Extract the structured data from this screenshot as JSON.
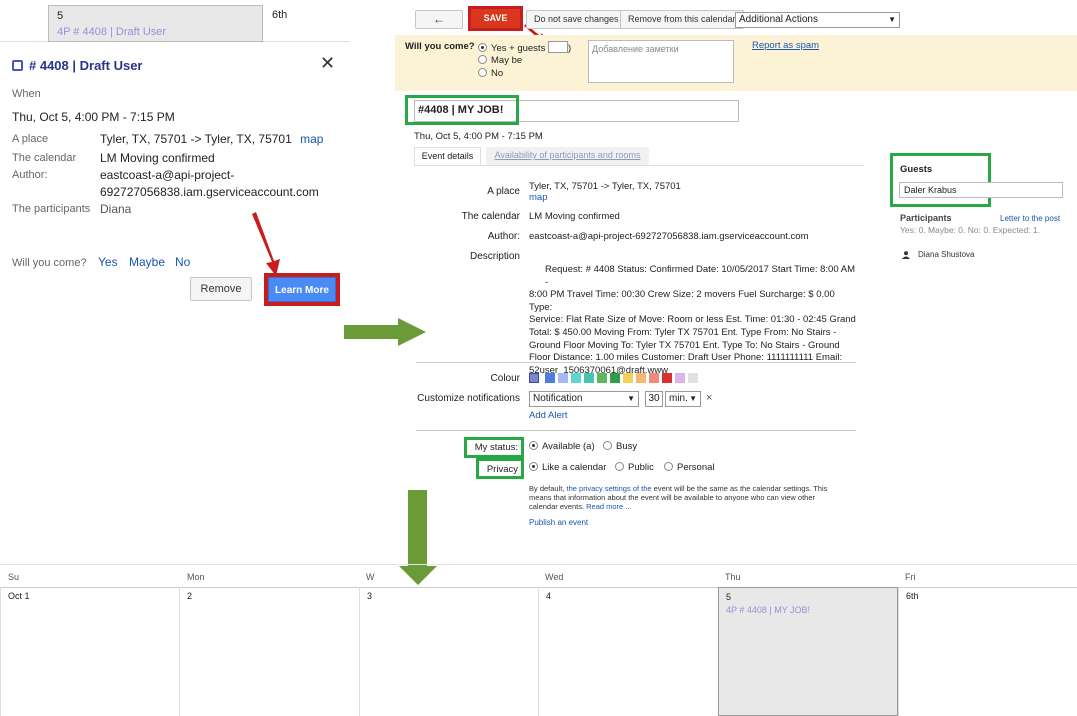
{
  "popup": {
    "cal_day_num": "5",
    "cal_event": "4P # 4408 | Draft User",
    "cal_next_day": "6th",
    "title": "# 4408 | Draft User",
    "when_label": "When",
    "when_value": "Thu, Oct 5, 4:00 PM - 7:15 PM",
    "place_label": "A place",
    "place_value": "Tyler, TX, 75701 -> Tyler, TX, 75701",
    "map_link": "map",
    "calendar_label": "The calendar",
    "calendar_value": "LM Moving confirmed",
    "author_label": "Author:",
    "author_value_1": "eastcoast-a@api-project-",
    "author_value_2": "692727056838.iam.gserviceaccount.com",
    "participants_label": "The participants",
    "participants_value": "Diana",
    "will_you_come": "Will you come?",
    "yes": "Yes",
    "maybe": "Maybe",
    "no": "No",
    "remove": "Remove",
    "learn_more": "Learn More"
  },
  "editor": {
    "back_icon": "←",
    "save": "SAVE",
    "dont_save": "Do not save changes",
    "remove_from_calendar": "Remove from this calendar",
    "additional_actions": "Additional Actions",
    "will_you_come": "Will you come?",
    "rsvp_yes": "Yes",
    "guests_plus": "+ guests",
    "rsvp_maybe": "May be",
    "rsvp_no": "No",
    "note_placeholder": "Добавление заметки",
    "report_spam": "Report as spam",
    "title_value": "#4408 | MY JOB!",
    "datetime": "Thu, Oct 5, 4:00 PM - 7:15 PM",
    "tab_details": "Event details",
    "tab_availability": "Availability of participants and rooms",
    "place_label": "A place",
    "place_value": "Tyler, TX, 75701 -> Tyler, TX, 75701",
    "map_link": "map",
    "calendar_label": "The calendar",
    "calendar_value": "LM Moving confirmed",
    "author_label": "Author:",
    "author_value": "eastcoast-a@api-project-692727056838.iam.gserviceaccount.com",
    "description_label": "Description",
    "description_lines": [
      "Request: # 4408 Status: Confirmed Date: 10/05/2017 Start Time: 8:00 AM -",
      "8:00 PM Travel Time: 00:30 Crew Size: 2 movers Fuel Surcharge: $ 0.00 Type:",
      "Service: Flat Rate Size of Move: Room or less Est. Time: 01:30 - 02:45 Grand",
      "Total: $ 450.00 Moving From: Tyler TX 75701 Ent. Type From: No Stairs -",
      "Ground Floor Moving To: Tyler TX 75701 Ent. Type To: No Stairs - Ground",
      "Floor Distance: 1.00 miles Customer: Draft User Phone: 1111111111 Email:",
      "52user_1506370061@draft.www"
    ],
    "colour_label": "Colour",
    "colours": [
      "#7986cb",
      "#4e7ce0",
      "#a4b8f5",
      "#5fd4d4",
      "#46c6b0",
      "#5fb85f",
      "#2f9e47",
      "#f5d15a",
      "#f5b86e",
      "#f0877a",
      "#d93030",
      "#dbb2f0",
      "#e1e1e1"
    ],
    "notifications_label": "Customize notifications",
    "notification_type": "Notification",
    "notification_amount": "30",
    "notification_unit": "min.",
    "notification_remove": "×",
    "add_alert": "Add Alert",
    "my_status_label": "My status:",
    "status_available": "Available (a)",
    "status_busy": "Busy",
    "privacy_label": "Privacy",
    "privacy_calendar": "Like a calendar",
    "privacy_public": "Public",
    "privacy_personal": "Personal",
    "privacy_note_1a": "By default, ",
    "privacy_note_1b": "the privacy settings of the",
    "privacy_note_1c": " event will be the same as the calendar settings. This",
    "privacy_note_2": "means that information about the event will be available to anyone who can view other",
    "privacy_note_3a": "calendar events. ",
    "privacy_note_3b": "Read more ...",
    "publish": "Publish an event",
    "guests_title": "Guests",
    "guests_input": "Daler Krabus",
    "participants_title": "Participants",
    "letter_link": "Letter to the post",
    "participants_summary": "Yes: 0. Maybe: 0. No: 0. Expected: 1.",
    "participant_name": "Diana Shustova"
  },
  "calendar": {
    "days": [
      "Su",
      "Mon",
      "W",
      "Wed",
      "Thu",
      "Fri"
    ],
    "dates": [
      "Oct 1",
      "2",
      "3",
      "4",
      "5",
      "6th"
    ],
    "event": "4P # 4408 | MY JOB!"
  }
}
